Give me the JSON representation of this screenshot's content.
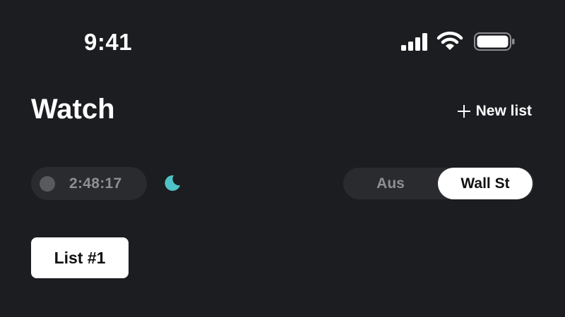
{
  "status_bar": {
    "time": "9:41",
    "icons": [
      "signal-icon",
      "wifi-icon",
      "battery-icon"
    ]
  },
  "header": {
    "title": "Watch",
    "new_list_label": "New list",
    "new_list_icon": "plus-icon"
  },
  "market_timer": {
    "time": "2:48:17",
    "status_icon": "circle-status-icon",
    "mode_icon": "moon-icon",
    "moon_color": "#4fc3c7"
  },
  "market_toggle": {
    "options": [
      "Aus",
      "Wall St"
    ],
    "selected": "Wall St"
  },
  "lists": {
    "tabs": [
      "List #1"
    ]
  }
}
